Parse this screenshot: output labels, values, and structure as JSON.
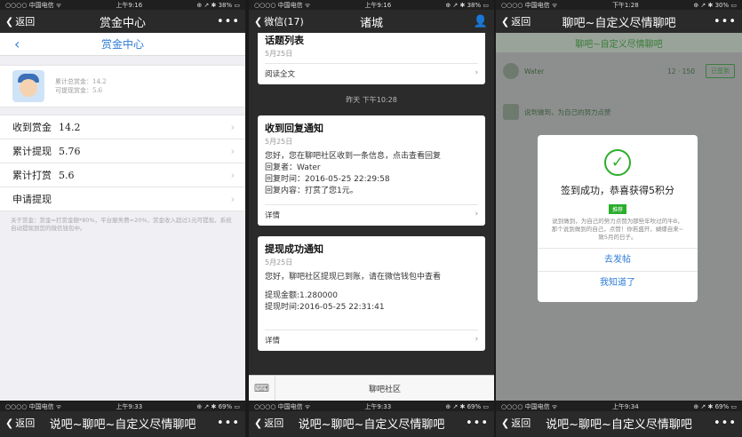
{
  "p1": {
    "status": {
      "carrier": "○○○○ 中国电信 ᯤ",
      "time": "上午9:16",
      "battery": "⊕ ↗ ✱ 38% ▭"
    },
    "nav": {
      "back": "返回",
      "title": "赏金中心",
      "more": "•••"
    },
    "subheader": {
      "title": "赏金中心"
    },
    "profile": {
      "total": "累计总赏金：14.2",
      "available": "可提现赏金：5.6"
    },
    "menu": [
      {
        "label": "收到赏金",
        "value": "14.2"
      },
      {
        "label": "累计提现",
        "value": "5.76"
      },
      {
        "label": "累计打赏",
        "value": "5.6"
      },
      {
        "label": "申请提现",
        "value": ""
      }
    ],
    "note": "关于赏金：赏金=打赏金额*80%，平台服务费=20%，赏金收入超过1元可提现，系统自动提现到您的微信钱包中。"
  },
  "p2": {
    "status": {
      "carrier": "○○○○ 中国电信 ᯤ",
      "time": "上午9:16",
      "battery": "⊕ ↗ ✱ 38% ▭"
    },
    "nav": {
      "back": "微信(17)",
      "title": "诸城",
      "user": "👤"
    },
    "card0": {
      "title": "话题列表",
      "date": "5月25日",
      "link": "阅读全文"
    },
    "time1": "昨天 下午10:28",
    "card1": {
      "title": "收到回复通知",
      "date": "5月25日",
      "lines": [
        "您好，您在聊吧社区收到一条信息，点击查看回复",
        "回复者：Water",
        "回复时间：2016-05-25 22:29:58",
        "回复内容：打赏了您1元。"
      ],
      "detail": "详情"
    },
    "card2": {
      "title": "提现成功通知",
      "date": "5月25日",
      "lines": [
        "您好，聊吧社区提现已到账，请在微信钱包中查看",
        "",
        "提现金额:1.280000",
        "提现时间:2016-05-25 22:31:41"
      ],
      "detail": "详情"
    },
    "bottom": {
      "label": "聊吧社区"
    }
  },
  "p3": {
    "status": {
      "carrier": "○○○○ 中国电信 ᯤ",
      "time": "下午1:28",
      "battery": "⊕ ↗ ✱ 30% ▭"
    },
    "nav": {
      "back": "返回",
      "title": "聊吧~自定义尽情聊吧",
      "more": "•••"
    },
    "bg": {
      "title": "聊吧~自定义尽情聊吧",
      "user": "Water",
      "stats": "12 · 150",
      "sign": "已签到",
      "line": "说到做到，为自己的努力点赞"
    },
    "dialog": {
      "check": "✓",
      "message": "签到成功，恭喜获得5积分",
      "tag": "推荐",
      "sub": "说到做到，为自己的努力点赞为那些年吹过的牛B，那个说到做到的自己，点赞！你若盛开，蝴蝶自来~致5月的日子。",
      "btn1": "去发帖",
      "btn2": "我知道了"
    }
  },
  "strips": [
    {
      "carrier": "○○○○ 中国电信 ᯤ",
      "time": "上午9:33",
      "battery": "⊕ ↗ ✱ 69% ▭",
      "back": "返回",
      "title": "说吧~聊吧~自定义尽情聊吧",
      "more": "•••"
    },
    {
      "carrier": "○○○○ 中国电信 ᯤ",
      "time": "上午9:33",
      "battery": "⊕ ↗ ✱ 69% ▭",
      "back": "返回",
      "title": "说吧~聊吧~自定义尽情聊吧",
      "more": "•••"
    },
    {
      "carrier": "○○○○ 中国电信 ᯤ",
      "time": "上午9:34",
      "battery": "⊕ ↗ ✱ 69% ▭",
      "back": "返回",
      "title": "说吧~聊吧~自定义尽情聊吧",
      "more": "•••"
    }
  ]
}
